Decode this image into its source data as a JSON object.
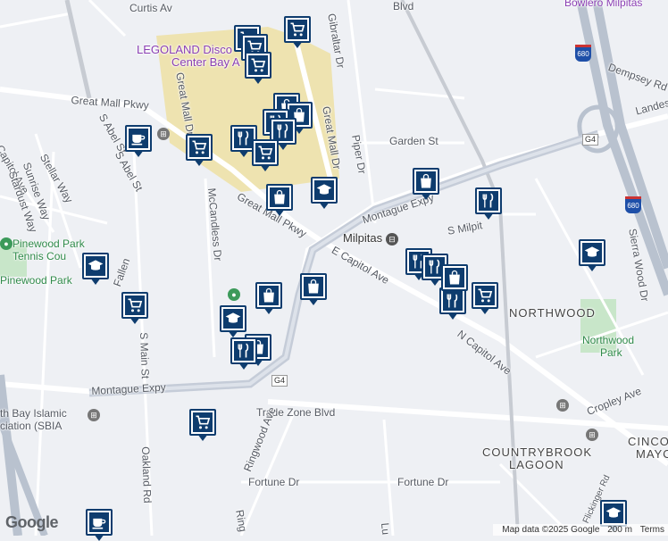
{
  "map": {
    "labels": {
      "curtis": "Curtis Av",
      "bowlero": "Bowlero Milpitas",
      "legoland1": "LEGOLAND Disco",
      "legoland2": "Center Bay A",
      "great_mall_pkwy": "Great Mall Pkwy",
      "great_mall_pkwy2": "Great Mall Pkwy",
      "great_mall_dr": "Great Mall Dr",
      "great_mall_dr2": "Great Mall Dr",
      "gibraltar": "Gibraltar Dr",
      "dempsey": "Dempsey Rd",
      "landess": "Landes",
      "garden": "Garden St",
      "piper": "Piper Dr",
      "montague_expy": "Montague Expy",
      "montague_expy2": "Montague Expy",
      "s_milpitas": "S Milpit",
      "milpitas": "Milpitas",
      "e_capitol": "E Capitol Ave",
      "n_capitol": "N Capitol Ave",
      "s_abel_st": "S Abel St",
      "s_abel_st2": "S Abel St",
      "capitol_ave_w": "Capitol Ave",
      "stellar": "Stellar Way",
      "sunrise": "Sunrise Way",
      "stardust": "Stardust Way",
      "pinewood1": "Pinewood Park",
      "pinewood2": "Tennis Cou",
      "pinewood3": "Pinewood Park",
      "mccandless": "McCandless Dr",
      "s_main": "S Main St",
      "oakland": "Oakland Rd",
      "fallen": "Fallen",
      "northwood": "NORTHWOOD",
      "northwood_park1": "Northwood",
      "northwood_park2": "Park",
      "sierra_wood": "Sierra Wood Dr",
      "cropley": "Cropley Ave",
      "trade_zone": "Trade Zone Blvd",
      "ringwood": "Ringwood Ave",
      "ringwood2": "Ring",
      "fortune1": "Fortune Dr",
      "fortune2": "Fortune Dr",
      "countrybrook1": "COUNTRYBROOK",
      "countrybrook2": "LAGOON",
      "cinco1": "CINCO",
      "cinco2": "MAYO",
      "islamic1": "th Bay Islamic",
      "islamic2": "ciation (SBIA",
      "flickinger": "Flickinger Rd",
      "lu": "Lu",
      "g4a": "G4",
      "g4b": "G4",
      "i680a": "680",
      "i680b": "680",
      "blvd": "Blvd"
    },
    "footer": {
      "logo": "Google",
      "attribution": "Map data ©2025 Google",
      "scale": "200 m",
      "terms": "Terms"
    },
    "pins": [
      {
        "type": "shopping-cart",
        "name": "pin-grocery-1"
      },
      {
        "type": "shopping-cart",
        "name": "pin-grocery-2"
      },
      {
        "type": "shopping-cart",
        "name": "pin-grocery-3"
      },
      {
        "type": "shopping-cart",
        "name": "pin-grocery-4"
      },
      {
        "type": "shopping-bag",
        "name": "pin-store-1"
      },
      {
        "type": "shopping-bag",
        "name": "pin-store-2"
      },
      {
        "type": "restaurant",
        "name": "pin-restaurant-1"
      },
      {
        "type": "restaurant",
        "name": "pin-restaurant-2"
      },
      {
        "type": "cafe",
        "name": "pin-cafe-1"
      },
      {
        "type": "shopping-cart",
        "name": "pin-grocery-5"
      },
      {
        "type": "restaurant",
        "name": "pin-restaurant-3"
      },
      {
        "type": "shopping-cart",
        "name": "pin-grocery-6"
      },
      {
        "type": "shopping-bag",
        "name": "pin-store-3"
      },
      {
        "type": "school",
        "name": "pin-school-1"
      },
      {
        "type": "shopping-bag",
        "name": "pin-store-4"
      },
      {
        "type": "restaurant",
        "name": "pin-restaurant-4"
      },
      {
        "type": "restaurant",
        "name": "pin-restaurant-5"
      },
      {
        "type": "restaurant",
        "name": "pin-restaurant-6"
      },
      {
        "type": "shopping-bag",
        "name": "pin-store-5"
      },
      {
        "type": "shopping-cart",
        "name": "pin-grocery-7"
      },
      {
        "type": "restaurant",
        "name": "pin-restaurant-7"
      },
      {
        "type": "school",
        "name": "pin-school-2"
      },
      {
        "type": "shopping-cart",
        "name": "pin-grocery-8"
      },
      {
        "type": "shopping-bag",
        "name": "pin-store-6"
      },
      {
        "type": "shopping-bag",
        "name": "pin-store-7"
      },
      {
        "type": "school",
        "name": "pin-school-3"
      },
      {
        "type": "restaurant",
        "name": "pin-restaurant-8"
      },
      {
        "type": "shopping-bag",
        "name": "pin-store-8"
      },
      {
        "type": "shopping-cart",
        "name": "pin-grocery-9"
      },
      {
        "type": "school",
        "name": "pin-school-4"
      },
      {
        "type": "cafe",
        "name": "pin-cafe-2"
      },
      {
        "type": "school",
        "name": "pin-school-5"
      }
    ],
    "colors": {
      "background": "#eef0f4",
      "highway": "#b9c2cf",
      "mall": "#eee3b0",
      "park": "#c8e6c9",
      "pin": "#0e3c6e"
    }
  }
}
